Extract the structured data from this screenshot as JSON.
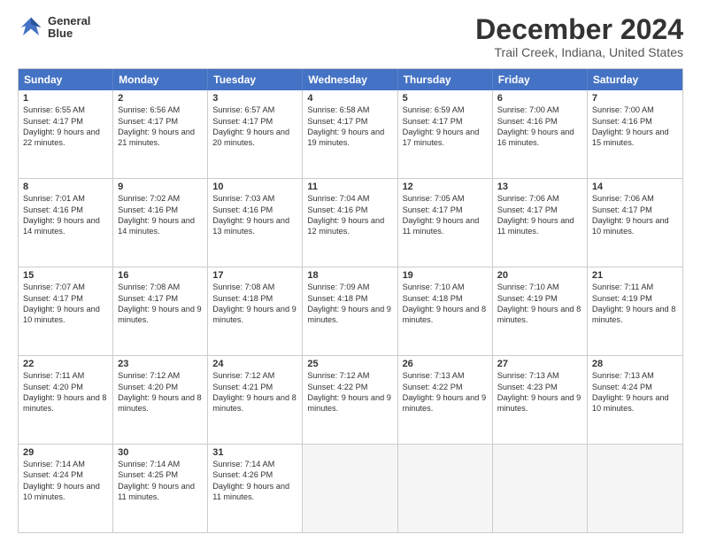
{
  "logo": {
    "line1": "General",
    "line2": "Blue"
  },
  "title": "December 2024",
  "subtitle": "Trail Creek, Indiana, United States",
  "days": [
    "Sunday",
    "Monday",
    "Tuesday",
    "Wednesday",
    "Thursday",
    "Friday",
    "Saturday"
  ],
  "weeks": [
    [
      {
        "day": "1",
        "sunrise": "6:55 AM",
        "sunset": "4:17 PM",
        "daylight": "9 hours and 22 minutes."
      },
      {
        "day": "2",
        "sunrise": "6:56 AM",
        "sunset": "4:17 PM",
        "daylight": "9 hours and 21 minutes."
      },
      {
        "day": "3",
        "sunrise": "6:57 AM",
        "sunset": "4:17 PM",
        "daylight": "9 hours and 20 minutes."
      },
      {
        "day": "4",
        "sunrise": "6:58 AM",
        "sunset": "4:17 PM",
        "daylight": "9 hours and 19 minutes."
      },
      {
        "day": "5",
        "sunrise": "6:59 AM",
        "sunset": "4:17 PM",
        "daylight": "9 hours and 17 minutes."
      },
      {
        "day": "6",
        "sunrise": "7:00 AM",
        "sunset": "4:16 PM",
        "daylight": "9 hours and 16 minutes."
      },
      {
        "day": "7",
        "sunrise": "7:00 AM",
        "sunset": "4:16 PM",
        "daylight": "9 hours and 15 minutes."
      }
    ],
    [
      {
        "day": "8",
        "sunrise": "7:01 AM",
        "sunset": "4:16 PM",
        "daylight": "9 hours and 14 minutes."
      },
      {
        "day": "9",
        "sunrise": "7:02 AM",
        "sunset": "4:16 PM",
        "daylight": "9 hours and 14 minutes."
      },
      {
        "day": "10",
        "sunrise": "7:03 AM",
        "sunset": "4:16 PM",
        "daylight": "9 hours and 13 minutes."
      },
      {
        "day": "11",
        "sunrise": "7:04 AM",
        "sunset": "4:16 PM",
        "daylight": "9 hours and 12 minutes."
      },
      {
        "day": "12",
        "sunrise": "7:05 AM",
        "sunset": "4:17 PM",
        "daylight": "9 hours and 11 minutes."
      },
      {
        "day": "13",
        "sunrise": "7:06 AM",
        "sunset": "4:17 PM",
        "daylight": "9 hours and 11 minutes."
      },
      {
        "day": "14",
        "sunrise": "7:06 AM",
        "sunset": "4:17 PM",
        "daylight": "9 hours and 10 minutes."
      }
    ],
    [
      {
        "day": "15",
        "sunrise": "7:07 AM",
        "sunset": "4:17 PM",
        "daylight": "9 hours and 10 minutes."
      },
      {
        "day": "16",
        "sunrise": "7:08 AM",
        "sunset": "4:17 PM",
        "daylight": "9 hours and 9 minutes."
      },
      {
        "day": "17",
        "sunrise": "7:08 AM",
        "sunset": "4:18 PM",
        "daylight": "9 hours and 9 minutes."
      },
      {
        "day": "18",
        "sunrise": "7:09 AM",
        "sunset": "4:18 PM",
        "daylight": "9 hours and 9 minutes."
      },
      {
        "day": "19",
        "sunrise": "7:10 AM",
        "sunset": "4:18 PM",
        "daylight": "9 hours and 8 minutes."
      },
      {
        "day": "20",
        "sunrise": "7:10 AM",
        "sunset": "4:19 PM",
        "daylight": "9 hours and 8 minutes."
      },
      {
        "day": "21",
        "sunrise": "7:11 AM",
        "sunset": "4:19 PM",
        "daylight": "9 hours and 8 minutes."
      }
    ],
    [
      {
        "day": "22",
        "sunrise": "7:11 AM",
        "sunset": "4:20 PM",
        "daylight": "9 hours and 8 minutes."
      },
      {
        "day": "23",
        "sunrise": "7:12 AM",
        "sunset": "4:20 PM",
        "daylight": "9 hours and 8 minutes."
      },
      {
        "day": "24",
        "sunrise": "7:12 AM",
        "sunset": "4:21 PM",
        "daylight": "9 hours and 8 minutes."
      },
      {
        "day": "25",
        "sunrise": "7:12 AM",
        "sunset": "4:22 PM",
        "daylight": "9 hours and 9 minutes."
      },
      {
        "day": "26",
        "sunrise": "7:13 AM",
        "sunset": "4:22 PM",
        "daylight": "9 hours and 9 minutes."
      },
      {
        "day": "27",
        "sunrise": "7:13 AM",
        "sunset": "4:23 PM",
        "daylight": "9 hours and 9 minutes."
      },
      {
        "day": "28",
        "sunrise": "7:13 AM",
        "sunset": "4:24 PM",
        "daylight": "9 hours and 10 minutes."
      }
    ],
    [
      {
        "day": "29",
        "sunrise": "7:14 AM",
        "sunset": "4:24 PM",
        "daylight": "9 hours and 10 minutes."
      },
      {
        "day": "30",
        "sunrise": "7:14 AM",
        "sunset": "4:25 PM",
        "daylight": "9 hours and 11 minutes."
      },
      {
        "day": "31",
        "sunrise": "7:14 AM",
        "sunset": "4:26 PM",
        "daylight": "9 hours and 11 minutes."
      },
      null,
      null,
      null,
      null
    ]
  ]
}
